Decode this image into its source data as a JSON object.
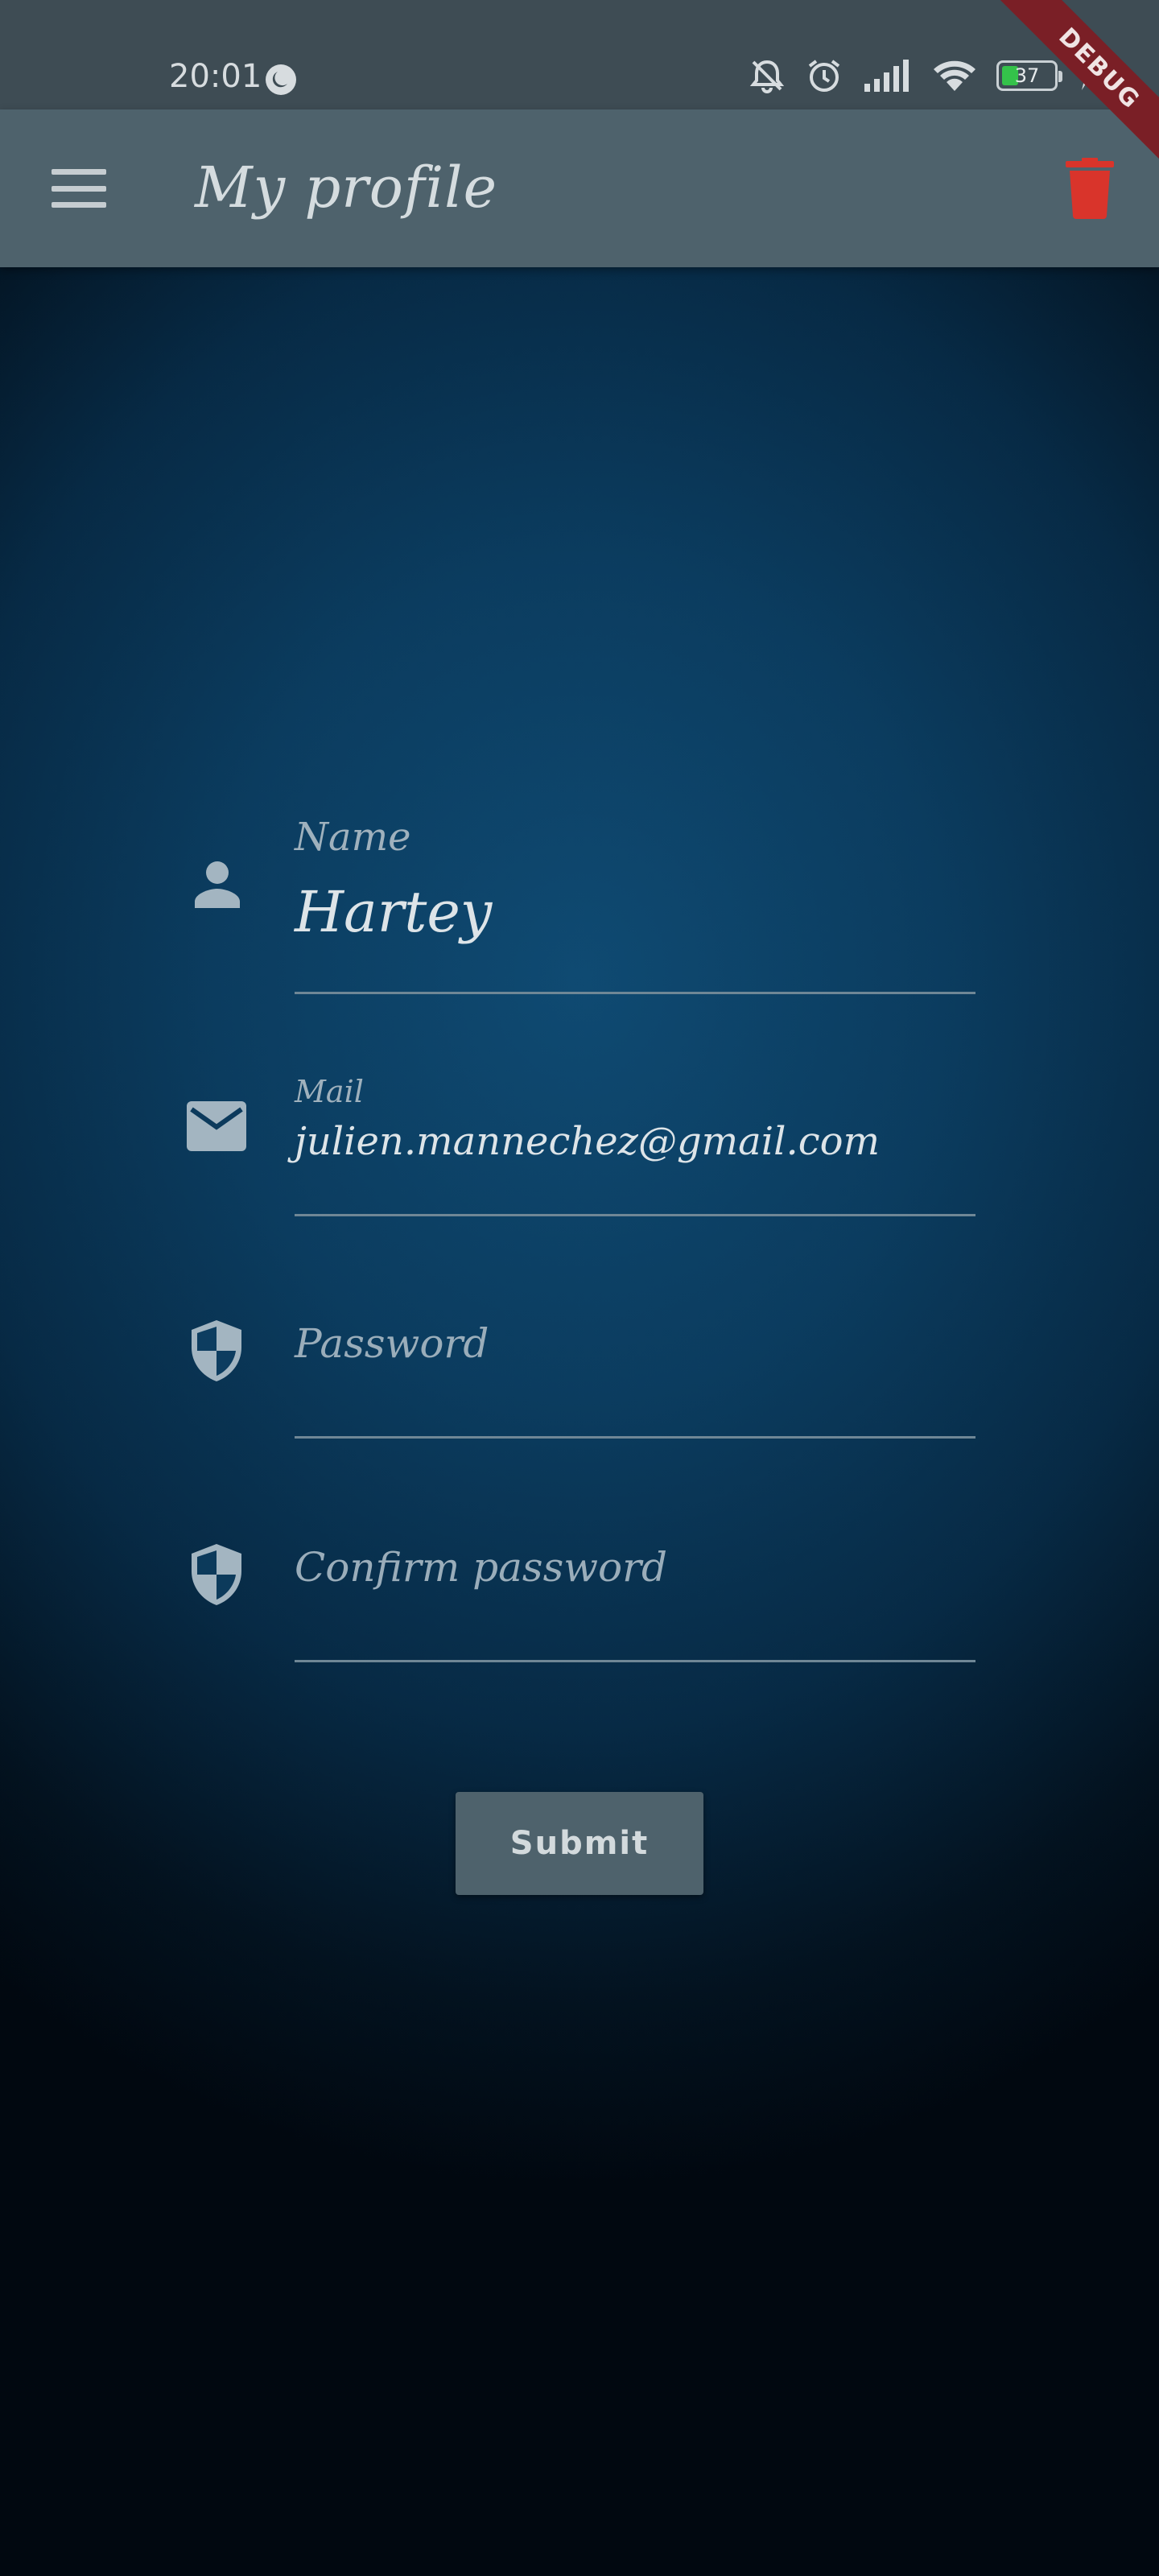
{
  "status_bar": {
    "time": "20:01",
    "battery_level": "37",
    "icons": [
      "dnd-moon-icon",
      "bell-off-icon",
      "alarm-icon",
      "signal-icon",
      "wifi-icon",
      "battery-icon",
      "charging-icon"
    ]
  },
  "debug_banner": "DEBUG",
  "app_bar": {
    "title": "My profile",
    "menu_icon": "hamburger-menu-icon",
    "delete_icon": "trash-icon",
    "delete_color": "#d9342b"
  },
  "form": {
    "name": {
      "label": "Name",
      "value": "Hartey",
      "icon": "person-icon"
    },
    "mail": {
      "label": "Mail",
      "value": "julien.mannechez@gmail.com",
      "icon": "mail-icon"
    },
    "password": {
      "placeholder": "Password",
      "icon": "shield-icon"
    },
    "confirm_password": {
      "placeholder": "Confirm password",
      "icon": "shield-icon"
    },
    "submit_label": "Submit"
  },
  "colors": {
    "app_bar": "#4e626c",
    "status_bar": "#3e4c54",
    "background_top": "#0f4a72",
    "background_bottom": "#010810"
  }
}
